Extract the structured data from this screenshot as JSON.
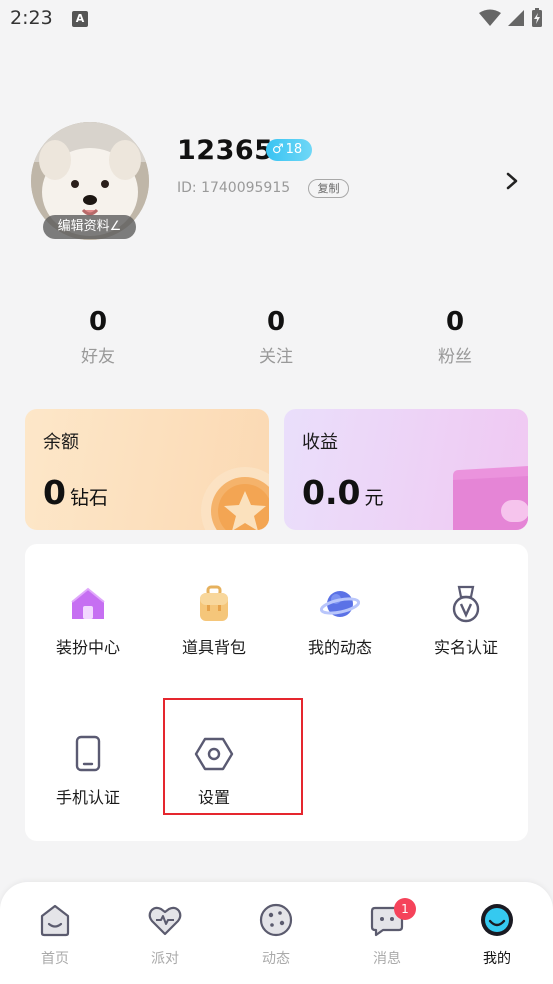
{
  "status_bar": {
    "time": "2:23",
    "notification_glyph": "A"
  },
  "profile": {
    "nickname": "12365",
    "gender_badge": {
      "symbol": "♂",
      "age": "18"
    },
    "user_id": "ID: 1740095915",
    "copy_label": "复制",
    "edit_label": "编辑资料∠"
  },
  "stats": [
    {
      "value": "0",
      "label": "好友"
    },
    {
      "value": "0",
      "label": "关注"
    },
    {
      "value": "0",
      "label": "粉丝"
    }
  ],
  "wallet": {
    "balance": {
      "title": "余额",
      "amount": "0",
      "unit": "钻石"
    },
    "income": {
      "title": "收益",
      "amount": "0.0",
      "unit": "元"
    }
  },
  "menu": [
    {
      "label": "装扮中心",
      "icon": "house-icon"
    },
    {
      "label": "道具背包",
      "icon": "backpack-icon"
    },
    {
      "label": "我的动态",
      "icon": "planet-icon"
    },
    {
      "label": "实名认证",
      "icon": "medal-icon"
    },
    {
      "label": "手机认证",
      "icon": "phone-icon"
    },
    {
      "label": "设置",
      "icon": "settings-hexagon-icon"
    }
  ],
  "tabs": [
    {
      "label": "首页",
      "icon": "home-icon",
      "active": false
    },
    {
      "label": "派对",
      "icon": "heart-pulse-icon",
      "active": false
    },
    {
      "label": "动态",
      "icon": "cookie-icon",
      "active": false
    },
    {
      "label": "消息",
      "icon": "chat-bubble-icon",
      "active": false,
      "badge": "1"
    },
    {
      "label": "我的",
      "icon": "smile-face-icon",
      "active": true
    }
  ],
  "colors": {
    "accent_blue": "#39c3f2",
    "badge_red": "#f5435a",
    "highlight_red": "#e5262e",
    "balance_card": "#fbd9b3",
    "income_card": "#f0c8f2"
  }
}
